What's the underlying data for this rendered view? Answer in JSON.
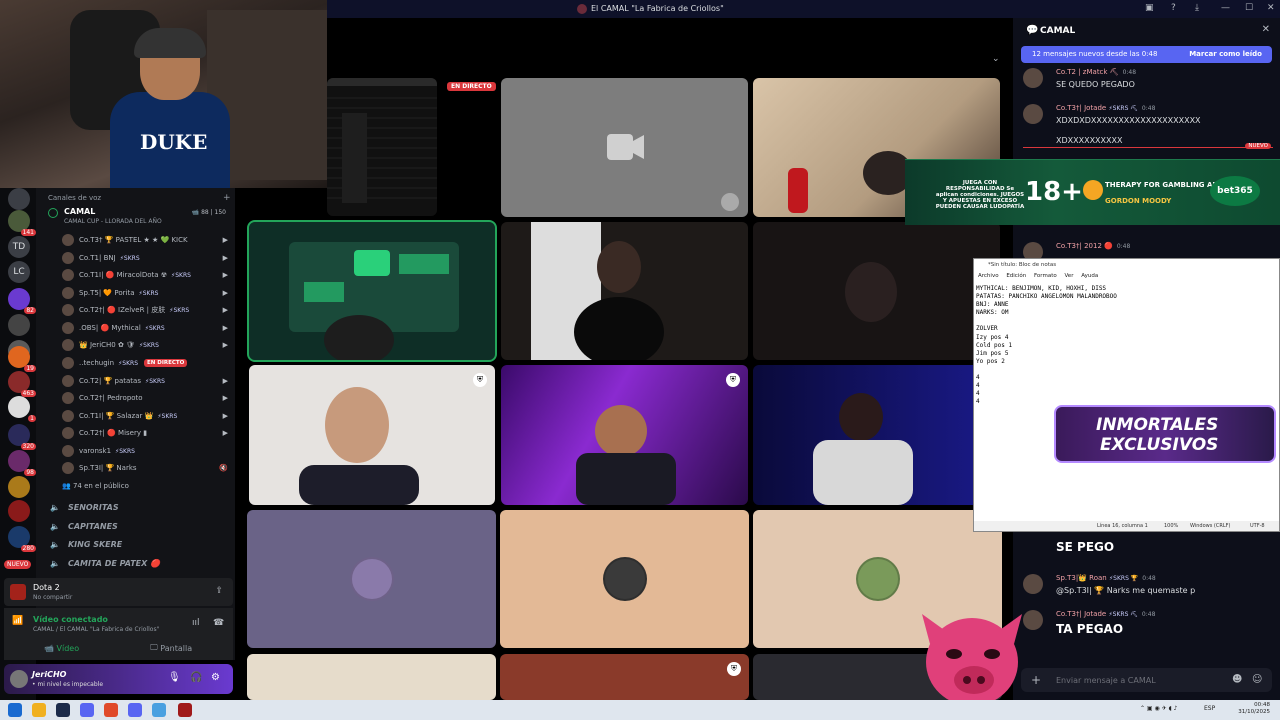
{
  "window": {
    "title": "El CAMAL \"La Fabrica de Criollos\""
  },
  "guilds": [
    {
      "label": "",
      "badge": ""
    },
    {
      "label": "",
      "badge": "141"
    },
    {
      "label": "TD",
      "badge": ""
    },
    {
      "label": "LC",
      "badge": ""
    },
    {
      "label": "",
      "badge": "82"
    },
    {
      "label": "",
      "badge": ""
    },
    {
      "label": "",
      "badge": ""
    },
    {
      "label": "",
      "badge": "19"
    },
    {
      "label": "",
      "badge": "463"
    },
    {
      "label": "",
      "badge": "1"
    },
    {
      "label": "",
      "badge": "320"
    },
    {
      "label": "",
      "badge": "98"
    },
    {
      "label": "",
      "badge": ""
    },
    {
      "label": "",
      "badge": ""
    },
    {
      "label": "",
      "badge": "280"
    }
  ],
  "guild_nuevo": "NUEVO",
  "sidebar": {
    "section_title": "Canales de voz",
    "active_channel": {
      "name": "CAMAL",
      "subtitle": "CAMAL CUP - LLORADA DEL AÑO",
      "count_a": "88",
      "count_b": "150"
    },
    "members": [
      {
        "name": "Co.T3† 🏆 PASTEL ★ ★ 💚 KICK",
        "tag": "",
        "live": ""
      },
      {
        "name": "Co.T1| BNJ",
        "tag": "⚡SKRS",
        "live": ""
      },
      {
        "name": "Co.T1I| 🔴 MiracolDota ☢",
        "tag": "⚡SKRS",
        "live": ""
      },
      {
        "name": "Sp.T5| 🧡 Porita",
        "tag": "⚡SKRS",
        "live": ""
      },
      {
        "name": "Co.T2†| 🔴 IZelveR | 皮肤",
        "tag": "⚡SKRS",
        "live": ""
      },
      {
        "name": ".OBS| 🔴 Mythical",
        "tag": "⚡SKRS",
        "live": ""
      },
      {
        "name": "👑 JeriCH0 ✿ 🛡",
        "tag": "⚡SKRS",
        "live": ""
      },
      {
        "name": "..techugin",
        "tag": "⚡SKRS",
        "live": "EN DIRECTO"
      },
      {
        "name": "Co.T2| 🏆 patatas",
        "tag": "⚡SKRS",
        "live": ""
      },
      {
        "name": "Co.T2†| Pedropoto",
        "tag": "",
        "live": ""
      },
      {
        "name": "Co.T1I| 🏆 Salazar 👑",
        "tag": "⚡SKRS",
        "live": ""
      },
      {
        "name": "Co.T2†| 🔴 Misery ▮",
        "tag": "",
        "live": ""
      },
      {
        "name": "varonsk1",
        "tag": "⚡SKRS",
        "live": ""
      },
      {
        "name": "Sp.T3I| 🏆 Narks",
        "tag": "",
        "live": ""
      }
    ],
    "audience": "74 en el público",
    "voice_channels": [
      "SENORITAS",
      "CAPITANES",
      "KING SKERE",
      "CAMITA DE PATEX 🔴"
    ]
  },
  "activity": {
    "title": "Dota 2",
    "subtitle": "No compartir"
  },
  "voice_status": {
    "title": "Vídeo conectado",
    "subtitle": "CAMAL / El CAMAL \"La Fabrica de Criollos\"",
    "video_label": "Vídeo",
    "screen_label": "Pantalla"
  },
  "user": {
    "name": "JeriCHO",
    "status": "• mi nivel es impecable"
  },
  "stage": {
    "live_badge": "EN DIRECTO"
  },
  "chat": {
    "channel_name": "CAMAL",
    "new_banner": "12 mensajes nuevos desde las 0:48",
    "mark_read": "Marcar como leído",
    "nuevo_divider": "NUEVO",
    "messages": [
      {
        "author": "Co.T2 | zMatck ⛏",
        "tag": "",
        "time": "0:48",
        "body": "SE QUEDO PEGADO",
        "big": false
      },
      {
        "author": "Co.T3†| Jotade",
        "tag": "⚡SKRS ⛏",
        "time": "0:48",
        "body": "XDXDXDXXXXXXXXXXXXXXXXXXXX",
        "big": false
      },
      {
        "author": "",
        "tag": "",
        "time": "",
        "body": "XDXXXXXXXXXX",
        "big": false
      },
      {
        "author": "Co.T3†| 2012 🔴",
        "tag": "",
        "time": "0:48",
        "body": "",
        "big": false
      },
      {
        "author": "",
        "tag": "",
        "time": "",
        "body": "SE PEGO",
        "big": true
      },
      {
        "author": "Sp.T3|👑 Roan",
        "tag": "⚡SKRS 🏆",
        "time": "0:48",
        "body": "@Sp.T3I| 🏆 Narks  me quemaste p",
        "big": false
      },
      {
        "author": "Co.T3†| Jotade",
        "tag": "⚡SKRS ⛏",
        "time": "0:48",
        "body": "TA PEGAO",
        "big": true
      }
    ],
    "input_placeholder": "Enviar mensaje a CAMAL"
  },
  "bet_banner": {
    "responsible": "JUEGA CON RESPONSABILIDAD Se aplican condiciones. JUEGOS Y APUESTAS EN EXCESO PUEDEN CAUSAR LUDOPATÍA",
    "age": "18+",
    "therapy": "THERAPY FOR GAMBLING ADDICTION",
    "gordon": "GORDON MOODY",
    "brand": "bet365"
  },
  "notepad": {
    "title": "*Sin título: Bloc de notas",
    "menu": [
      "Archivo",
      "Edición",
      "Formato",
      "Ver",
      "Ayuda"
    ],
    "content": "MYTHICAL: BENJIMON, KID, HOXHI, DISS\nPATATAS: PANCHIKO ANGELOMON MALANDROBOO\nBNJ: ANNE\nNARKS: OM\n\nZOLVER\nIzy pos 4\nCold pos 1\nJim pos 5\nYo pos 2\n\n4\n4\n4\n4",
    "status_pos": "Línea 16, columna 1",
    "status_zoom": "100%",
    "status_eol": "Windows (CRLF)",
    "status_enc": "UTF-8"
  },
  "inmortales": {
    "line1": "INMORTALES",
    "line2": "EXCLUSIVOS"
  },
  "streamer": {
    "shirt_text": "DUKE"
  },
  "taskbar": {
    "lang": "ESP",
    "time": "00:48",
    "date": "31/10/2025"
  }
}
